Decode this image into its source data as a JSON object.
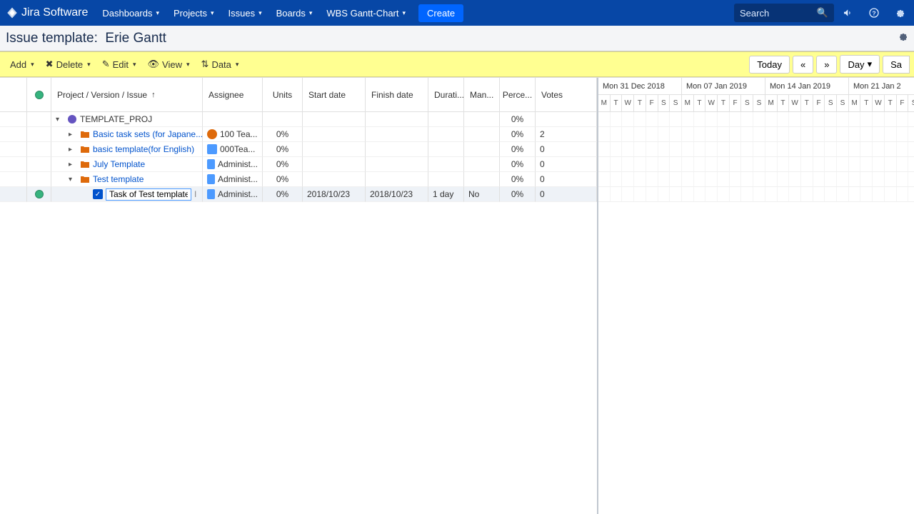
{
  "topnav": {
    "product": "Jira Software",
    "items": [
      "Dashboards",
      "Projects",
      "Issues",
      "Boards",
      "WBS Gantt-Chart"
    ],
    "create": "Create",
    "search_placeholder": "Search"
  },
  "titlebar": {
    "label": "Issue template:",
    "value": "Erie Gantt"
  },
  "toolbar": {
    "add": "Add",
    "delete": "Delete",
    "edit": "Edit",
    "view": "View",
    "data": "Data",
    "today": "Today",
    "scale": "Day",
    "save": "Sa"
  },
  "grid": {
    "columns": {
      "name": "Project / Version / Issue",
      "assignee": "Assignee",
      "units": "Units",
      "start": "Start date",
      "finish": "Finish date",
      "duration": "Durati...",
      "man": "Man...",
      "perc": "Perce...",
      "votes": "Votes"
    },
    "rows": [
      {
        "indent": 0,
        "expanded": true,
        "icon": "project",
        "name": "TEMPLATE_PROJ",
        "assignee": "",
        "units": "",
        "start": "",
        "finish": "",
        "duration": "",
        "man": "",
        "perc": "0%",
        "votes": "",
        "status": ""
      },
      {
        "indent": 1,
        "expanded": false,
        "icon": "folder",
        "name": "Basic task sets (for Japane...",
        "assignee": "100 Tea...",
        "assignee_icon": "circ",
        "units": "0%",
        "start": "",
        "finish": "",
        "duration": "",
        "man": "",
        "perc": "0%",
        "votes": "2",
        "status": ""
      },
      {
        "indent": 1,
        "expanded": false,
        "icon": "folder",
        "name": "basic template(for English)",
        "assignee": "000Tea...",
        "assignee_icon": "sq",
        "units": "0%",
        "start": "",
        "finish": "",
        "duration": "",
        "man": "",
        "perc": "0%",
        "votes": "0",
        "status": ""
      },
      {
        "indent": 1,
        "expanded": false,
        "icon": "folder",
        "name": "July Template",
        "assignee": "Administ...",
        "assignee_icon": "sq",
        "units": "0%",
        "start": "",
        "finish": "",
        "duration": "",
        "man": "",
        "perc": "0%",
        "votes": "0",
        "status": ""
      },
      {
        "indent": 1,
        "expanded": true,
        "icon": "folder",
        "name": "Test template",
        "assignee": "Administ...",
        "assignee_icon": "sq",
        "units": "0%",
        "start": "",
        "finish": "",
        "duration": "",
        "man": "",
        "perc": "0%",
        "votes": "0",
        "status": ""
      },
      {
        "indent": 2,
        "expanded": null,
        "icon": "task",
        "name": "Task of Test template",
        "editing": true,
        "assignee": "Administ...",
        "assignee_icon": "sq",
        "units": "0%",
        "start": "2018/10/23",
        "finish": "2018/10/23",
        "duration": "1 day",
        "man": "No",
        "perc": "0%",
        "votes": "0",
        "status": "green",
        "selected": true
      }
    ]
  },
  "timeline": {
    "weeks": [
      "Mon 31 Dec 2018",
      "Mon 07 Jan 2019",
      "Mon 14 Jan 2019",
      "Mon 21 Jan 2"
    ],
    "days": [
      "M",
      "T",
      "W",
      "T",
      "F",
      "S",
      "S"
    ]
  }
}
